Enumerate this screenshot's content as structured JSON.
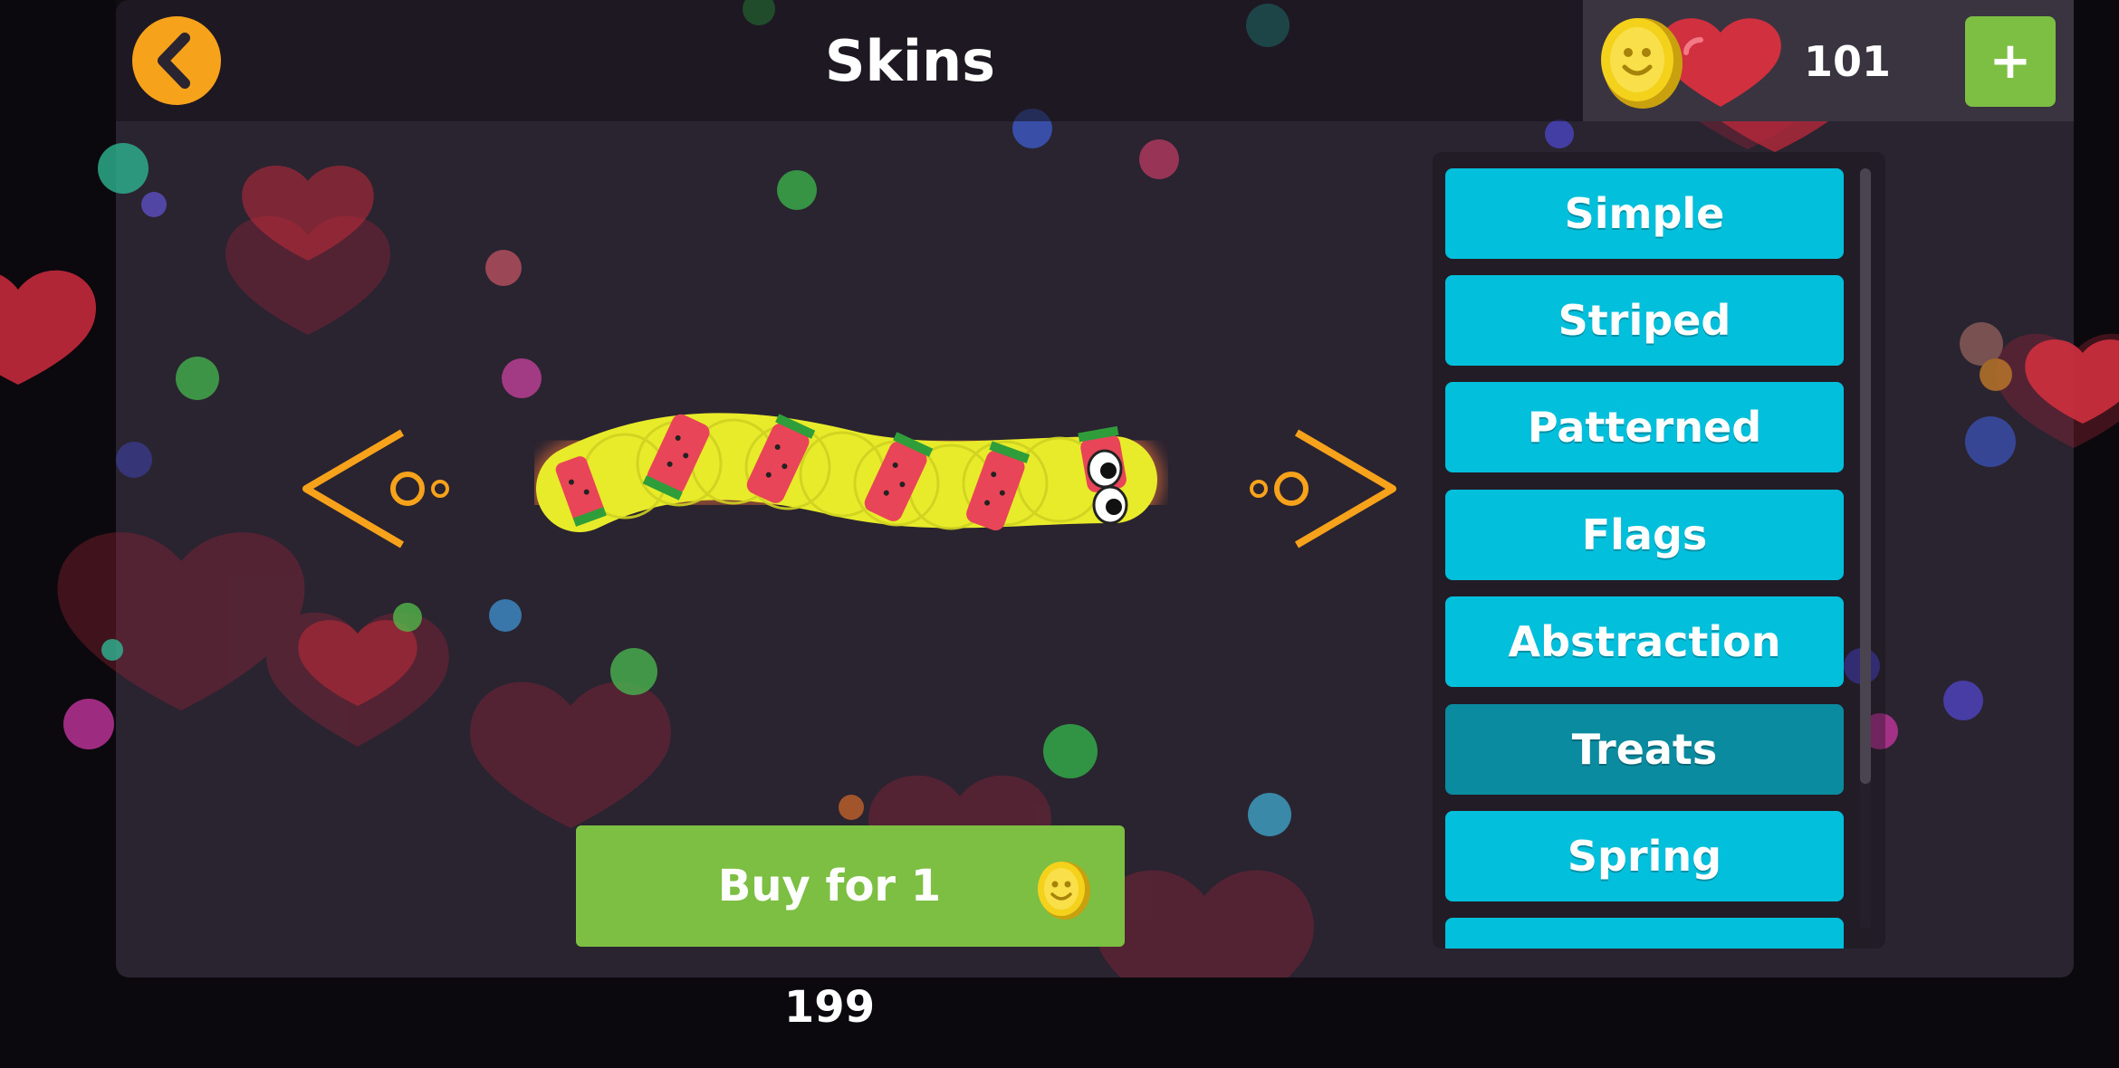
{
  "header": {
    "title": "Skins",
    "back_icon": "chevron-left-icon",
    "coin_icon": "smiley-coin-icon",
    "heart_icon": "heart-icon",
    "coin_count": "101",
    "add_coins_label": "+"
  },
  "preview": {
    "prev_icon": "arrow-left-icon",
    "next_icon": "arrow-right-icon",
    "skin": "watermelon-worm"
  },
  "categories": {
    "items": [
      {
        "label": "Simple"
      },
      {
        "label": "Striped"
      },
      {
        "label": "Patterned"
      },
      {
        "label": "Flags"
      },
      {
        "label": "Abstraction"
      },
      {
        "label": "Treats"
      },
      {
        "label": "Spring"
      }
    ],
    "selected": "Treats"
  },
  "buy": {
    "label": "Buy for 1 199",
    "coin_icon": "smiley-coin-icon"
  },
  "colors": {
    "panel": "#2a2330",
    "accent_orange": "#f7a21b",
    "category_button": "#02bfdc",
    "category_selected": "#0a8ba0",
    "buy_green": "#7cbf43"
  }
}
